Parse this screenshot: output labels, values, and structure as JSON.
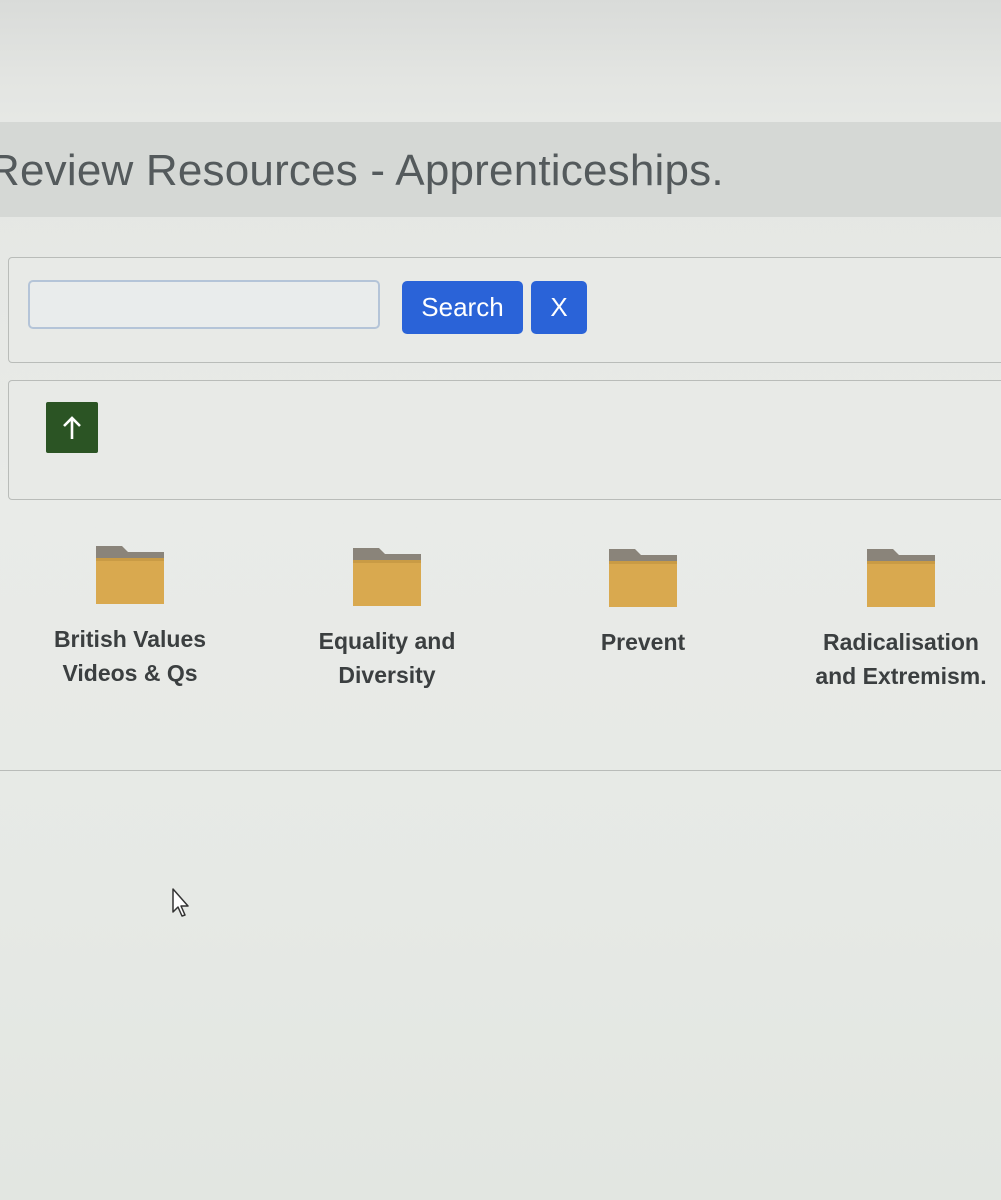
{
  "header": {
    "title": "Review Resources - Apprenticeships."
  },
  "search": {
    "value": "",
    "placeholder": "",
    "search_label": "Search",
    "clear_label": "X"
  },
  "navigation": {
    "up_icon": "arrow-up-icon"
  },
  "folders": [
    {
      "label": "British Values\nVideos & Qs",
      "icon": "folder-icon"
    },
    {
      "label": "Equality and\nDiversity",
      "icon": "folder-icon"
    },
    {
      "label": "Prevent",
      "icon": "folder-icon"
    },
    {
      "label": "Radicalisation\nand Extremism.",
      "icon": "folder-icon"
    }
  ],
  "colors": {
    "primary_button": "#2a63d8",
    "up_button": "#2b5424",
    "folder_body": "#d9a94f",
    "folder_tab": "#8a847a"
  }
}
